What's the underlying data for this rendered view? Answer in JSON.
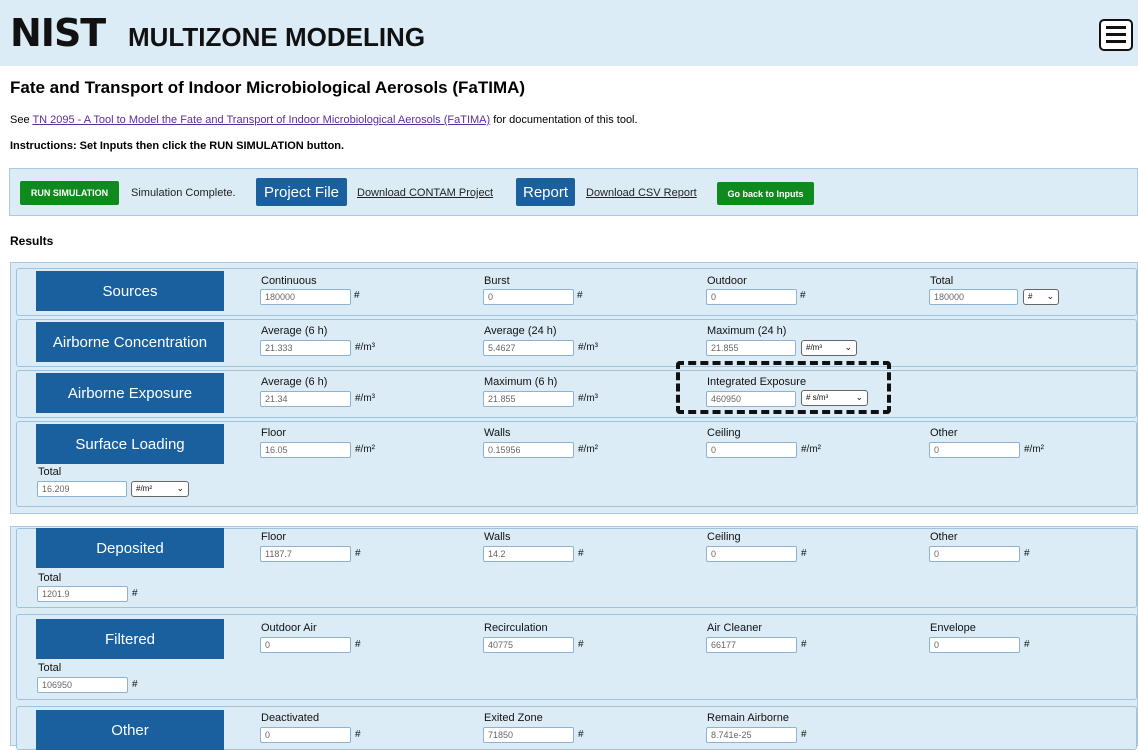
{
  "header": {
    "logo": "NIST",
    "app_title": "MULTIZONE MODELING",
    "menu_icon": "hamburger-icon"
  },
  "page": {
    "title": "Fate and Transport of Indoor Microbiological Aerosols (FaTIMA)",
    "see_prefix": "See",
    "doc_link": "TN 2095 - A Tool to Model the Fate and Transport of Indoor Microbiological Aerosols (FaTIMA)",
    "see_suffix": "for documentation of this tool.",
    "instructions": "Instructions: Set Inputs then click the RUN SIMULATION button."
  },
  "toolbar": {
    "run_label": "RUN SIMULATION",
    "status": "Simulation Complete.",
    "project_file": "Project File",
    "download_contam": "Download CONTAM Project",
    "report": "Report",
    "download_csv": "Download CSV Report",
    "back": "Go back to Inputs"
  },
  "results_heading": "Results",
  "panels": {
    "sources": {
      "title": "Sources",
      "fields": [
        {
          "label": "Continuous",
          "value": "180000",
          "unit": "#"
        },
        {
          "label": "Burst",
          "value": "0",
          "unit": "#"
        },
        {
          "label": "Outdoor",
          "value": "0",
          "unit": "#"
        },
        {
          "label": "Total",
          "value": "180000",
          "select": "#"
        }
      ]
    },
    "airborne_concentration": {
      "title": "Airborne Concentration",
      "fields": [
        {
          "label": "Average (6 h)",
          "value": "21.333",
          "unit": "#/m³"
        },
        {
          "label": "Average (24 h)",
          "value": "5.4627",
          "unit": "#/m³"
        },
        {
          "label": "Maximum (24 h)",
          "value": "21.855",
          "select": "#/m³"
        }
      ]
    },
    "airborne_exposure": {
      "title": "Airborne Exposure",
      "fields": [
        {
          "label": "Average (6 h)",
          "value": "21.34",
          "unit": "#/m³"
        },
        {
          "label": "Maximum (6 h)",
          "value": "21.855",
          "unit": "#/m³"
        },
        {
          "label": "Integrated Exposure",
          "value": "460950",
          "select": "# s/m³"
        }
      ]
    },
    "surface_loading": {
      "title": "Surface Loading",
      "fields": [
        {
          "label": "Floor",
          "value": "16.05",
          "unit": "#/m²"
        },
        {
          "label": "Walls",
          "value": "0.15956",
          "unit": "#/m²"
        },
        {
          "label": "Ceiling",
          "value": "0",
          "unit": "#/m²"
        },
        {
          "label": "Other",
          "value": "0",
          "unit": "#/m²"
        }
      ],
      "total": {
        "label": "Total",
        "value": "16.209",
        "select": "#/m²"
      }
    },
    "deposited": {
      "title": "Deposited",
      "fields": [
        {
          "label": "Floor",
          "value": "1187.7",
          "unit": "#"
        },
        {
          "label": "Walls",
          "value": "14.2",
          "unit": "#"
        },
        {
          "label": "Ceiling",
          "value": "0",
          "unit": "#"
        },
        {
          "label": "Other",
          "value": "0",
          "unit": "#"
        }
      ],
      "total": {
        "label": "Total",
        "value": "1201.9",
        "unit": "#"
      }
    },
    "filtered": {
      "title": "Filtered",
      "fields": [
        {
          "label": "Outdoor Air",
          "value": "0",
          "unit": "#"
        },
        {
          "label": "Recirculation",
          "value": "40775",
          "unit": "#"
        },
        {
          "label": "Air Cleaner",
          "value": "66177",
          "unit": "#"
        },
        {
          "label": "Envelope",
          "value": "0",
          "unit": "#"
        }
      ],
      "total": {
        "label": "Total",
        "value": "106950",
        "unit": "#"
      }
    },
    "other": {
      "title": "Other",
      "fields": [
        {
          "label": "Deactivated",
          "value": "0",
          "unit": "#"
        },
        {
          "label": "Exited Zone",
          "value": "71850",
          "unit": "#"
        },
        {
          "label": "Remain Airborne",
          "value": "8.741e-25",
          "unit": "#"
        }
      ]
    }
  },
  "colors": {
    "header_bg": "#dcecf7",
    "panel_blue": "#1a609e",
    "green": "#0e8a1e",
    "link_purple": "#5b2e9c"
  }
}
